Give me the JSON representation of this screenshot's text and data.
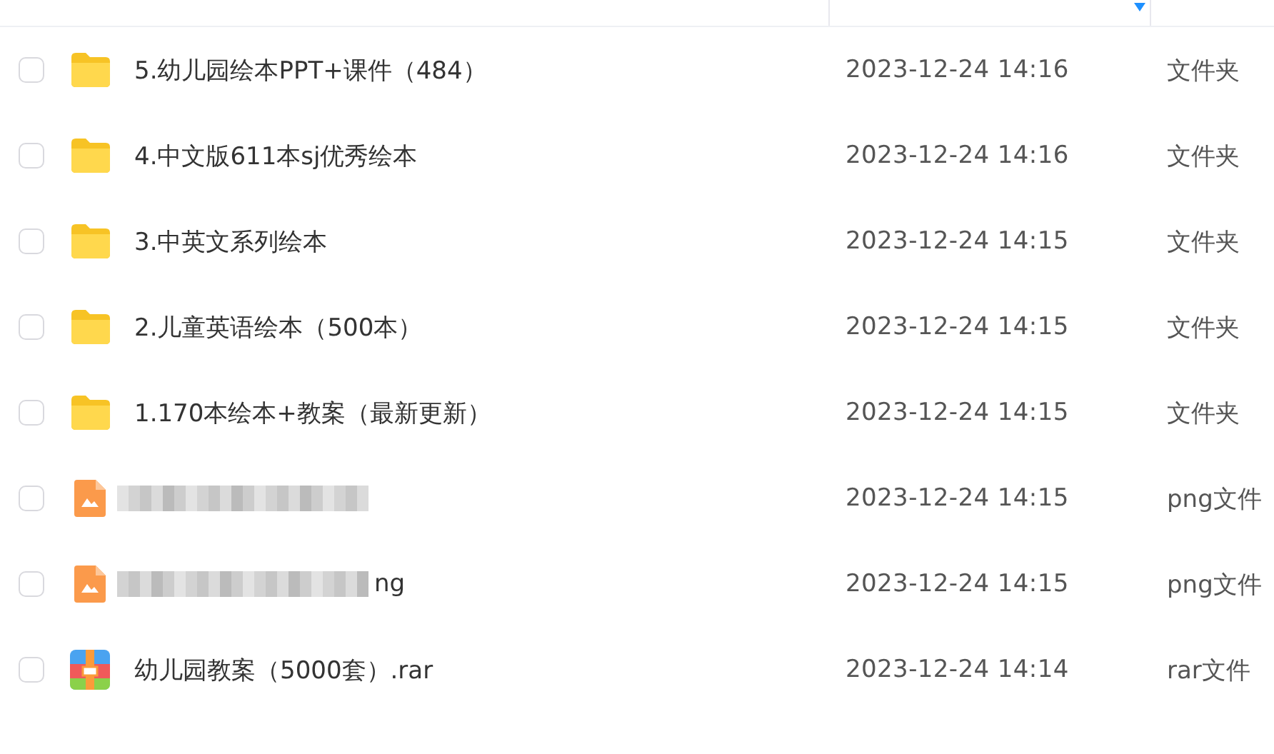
{
  "rows": [
    {
      "kind": "folder",
      "name": "5.幼儿园绘本PPT+课件（484）",
      "modified": "2023-12-24 14:16",
      "type": "文件夹",
      "checked": false,
      "redacted": false
    },
    {
      "kind": "folder",
      "name": "4.中文版611本sj优秀绘本",
      "modified": "2023-12-24 14:16",
      "type": "文件夹",
      "checked": false,
      "redacted": false
    },
    {
      "kind": "folder",
      "name": "3.中英文系列绘本",
      "modified": "2023-12-24 14:15",
      "type": "文件夹",
      "checked": false,
      "redacted": false
    },
    {
      "kind": "folder",
      "name": "2.儿童英语绘本（500本）",
      "modified": "2023-12-24 14:15",
      "type": "文件夹",
      "checked": false,
      "redacted": false
    },
    {
      "kind": "folder",
      "name": "1.170本绘本+教案（最新更新）",
      "modified": "2023-12-24 14:15",
      "type": "文件夹",
      "checked": false,
      "redacted": false
    },
    {
      "kind": "image",
      "modified": "2023-12-24 14:15",
      "type": "png文件",
      "checked": false,
      "redacted": true
    },
    {
      "kind": "image",
      "name": "ng",
      "modified": "2023-12-24 14:15",
      "type": "png文件",
      "checked": false,
      "redacted": true
    },
    {
      "kind": "archive",
      "name": "幼儿园教案（5000套）.rar",
      "modified": "2023-12-24 14:14",
      "type": "rar文件",
      "checked": false,
      "redacted": false
    }
  ]
}
